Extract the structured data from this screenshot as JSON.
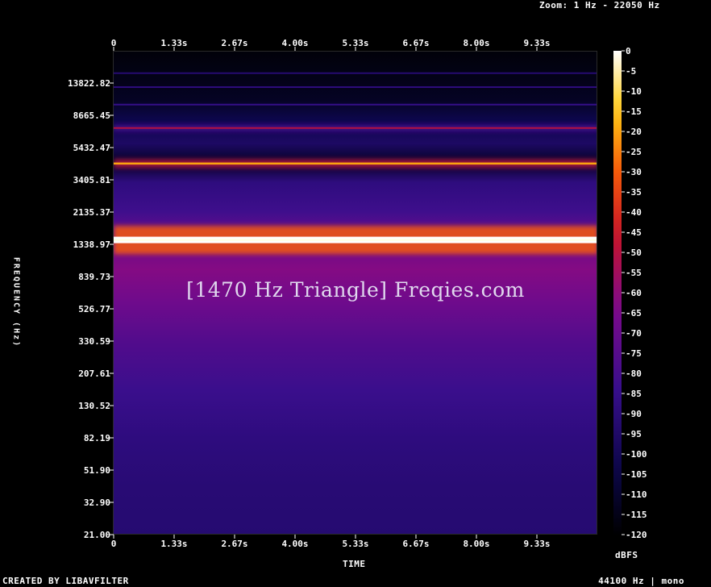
{
  "header": {
    "zoom": "Zoom: 1 Hz - 22050 Hz"
  },
  "footer": {
    "credit": "CREATED BY LIBAVFILTER",
    "rate": "44100 Hz | mono"
  },
  "colors": {
    "background": "#000000",
    "ridge": "#fffbd0",
    "floor": "#3a0f8c"
  },
  "chart_data": {
    "type": "heatmap",
    "title": "[1470 Hz Triangle] Freqies.com",
    "xlabel": "TIME",
    "ylabel": "FREQUENCY (Hz)",
    "x_ticks": [
      "0",
      "1.33s",
      "2.67s",
      "4.00s",
      "5.33s",
      "6.67s",
      "8.00s",
      "9.33s"
    ],
    "y_ticks": [
      "21.00",
      "32.90",
      "51.90",
      "82.19",
      "130.52",
      "207.61",
      "330.59",
      "526.77",
      "839.73",
      "1338.97",
      "2135.37",
      "3405.81",
      "5432.47",
      "8665.45",
      "13822.82"
    ],
    "y_scale": "log",
    "colorbar": {
      "unit": "dBFS",
      "ticks": [
        "0",
        "-5",
        "-10",
        "-15",
        "-20",
        "-25",
        "-30",
        "-35",
        "-40",
        "-45",
        "-50",
        "-55",
        "-60",
        "-65",
        "-70",
        "-75",
        "-80",
        "-85",
        "-90",
        "-95",
        "-100",
        "-105",
        "-110",
        "-115",
        "-120"
      ],
      "range": [
        -120,
        0
      ]
    },
    "bands": [
      {
        "freq_hz": 1470,
        "level_dbfs": 0
      },
      {
        "freq_hz": 4410,
        "level_dbfs": -20
      },
      {
        "freq_hz": 7350,
        "level_dbfs": -50
      },
      {
        "freq_hz": 10290,
        "level_dbfs": -85
      },
      {
        "freq_hz": 13230,
        "level_dbfs": -88
      },
      {
        "freq_hz": 16170,
        "level_dbfs": -92
      }
    ]
  }
}
